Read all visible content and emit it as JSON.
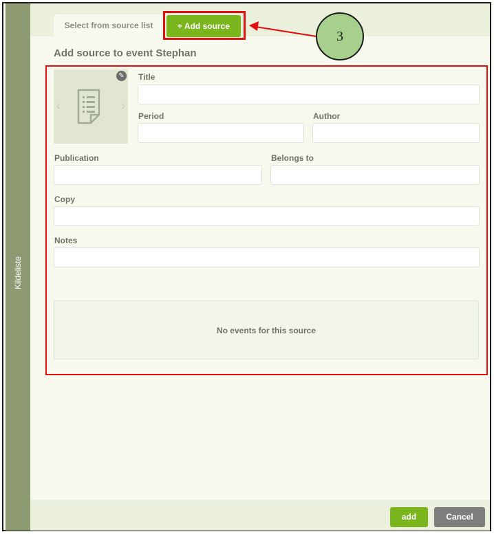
{
  "sidebar": {
    "label": "Kildeliste"
  },
  "tabs": {
    "select_label": "Select from source list",
    "add_label": "+ Add source"
  },
  "callout": {
    "number": "3"
  },
  "panel": {
    "title": "Add source to event Stephan"
  },
  "form": {
    "title_label": "Title",
    "title_value": "",
    "period_label": "Period",
    "period_value": "",
    "author_label": "Author",
    "author_value": "",
    "publication_label": "Publication",
    "publication_value": "",
    "belongs_to_label": "Belongs to",
    "belongs_to_value": "",
    "copy_label": "Copy",
    "copy_value": "",
    "notes_label": "Notes",
    "notes_value": ""
  },
  "events": {
    "empty_text": "No events for this source"
  },
  "footer": {
    "add_label": "add",
    "cancel_label": "Cancel"
  },
  "icons": {
    "edit": "pencil-icon",
    "prev": "chevron-left-icon",
    "next": "chevron-right-icon",
    "document": "document-icon"
  },
  "colors": {
    "accent_green": "#7ab51d",
    "sidebar": "#8d9a72",
    "highlight_red": "#e20f0f",
    "callout_fill": "#a8d08d",
    "cancel_gray": "#7d7d7d"
  }
}
